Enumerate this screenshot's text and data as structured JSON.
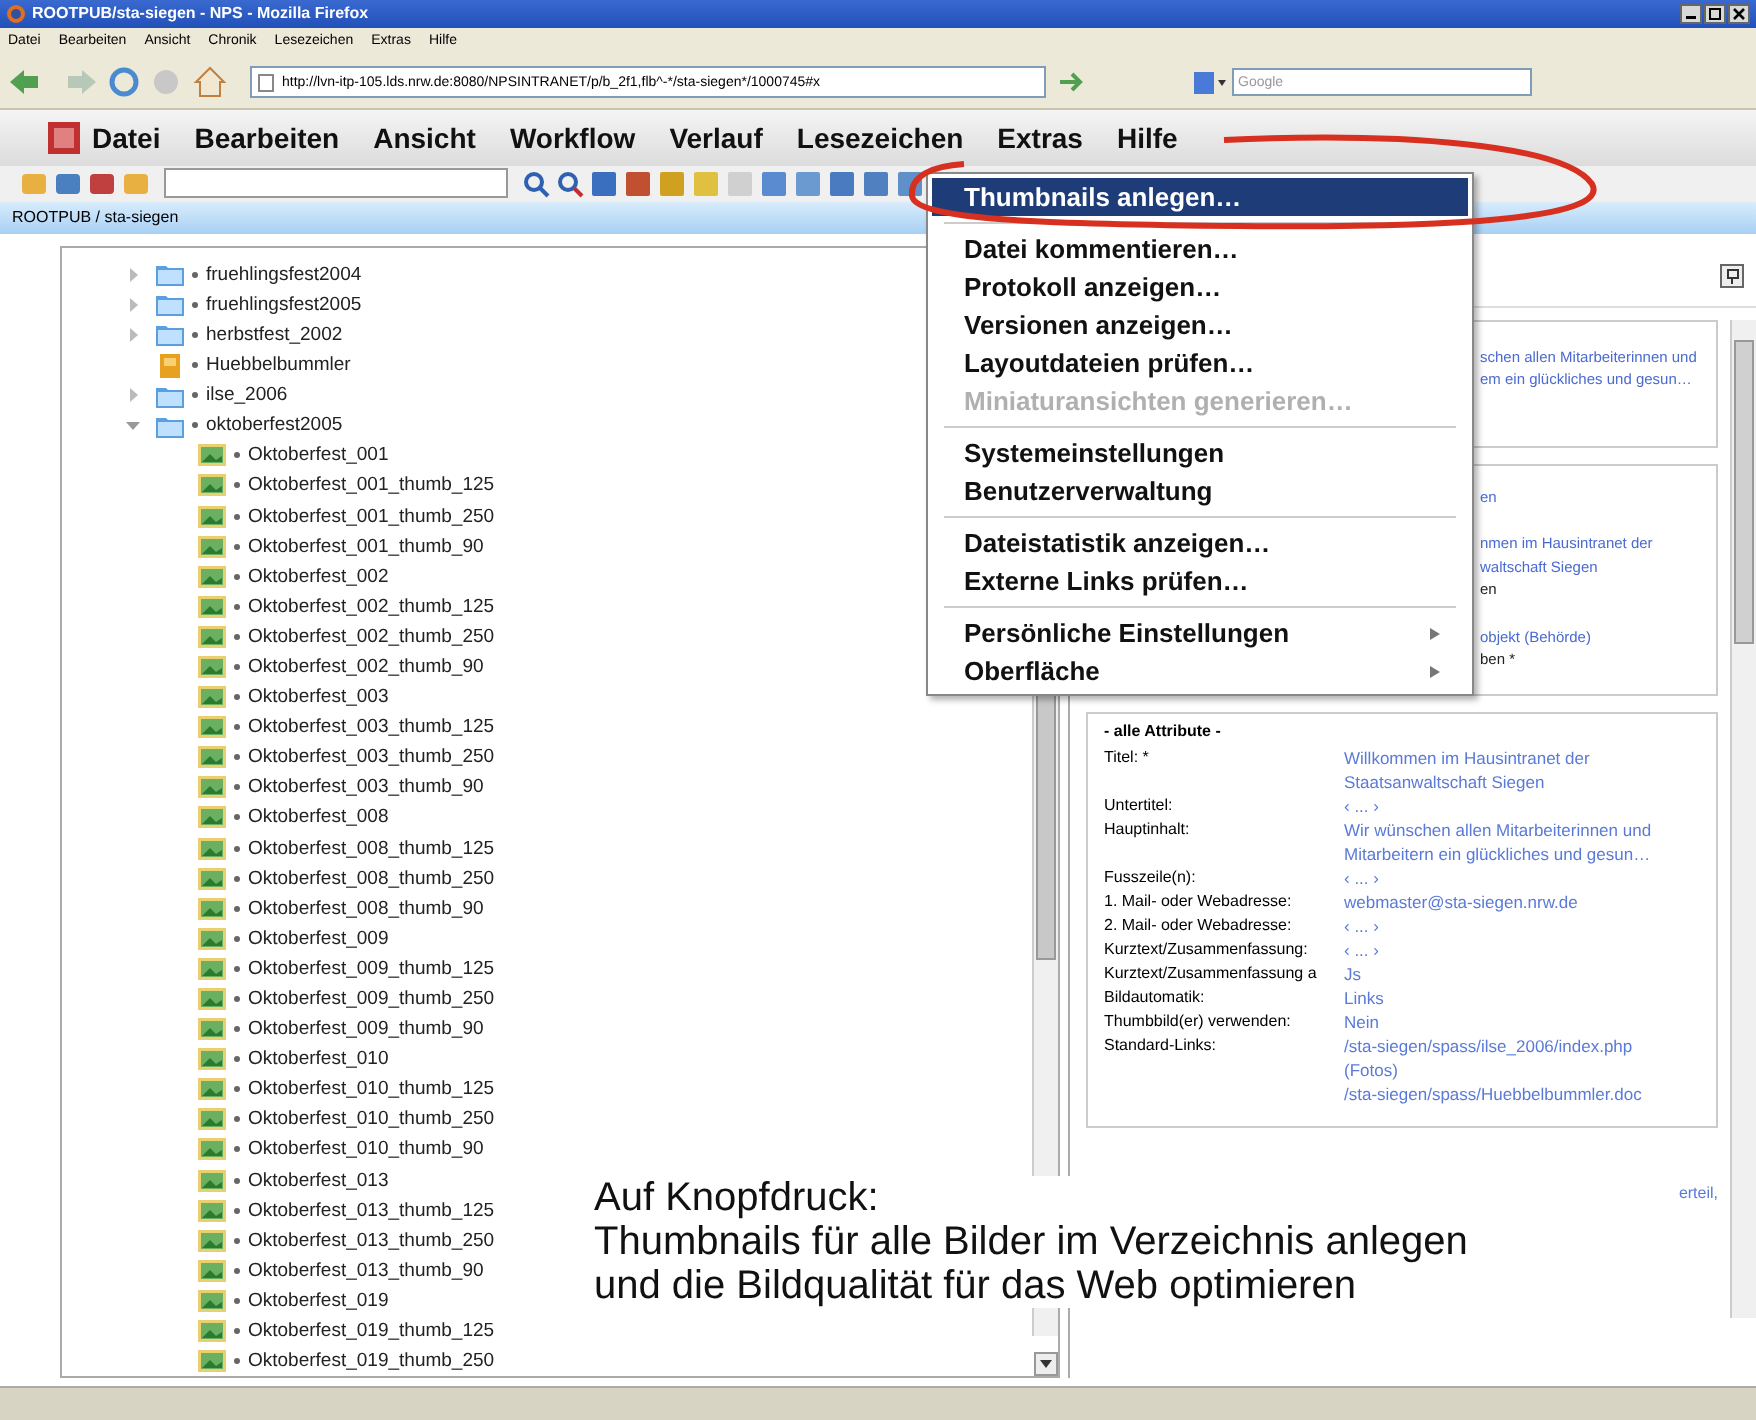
{
  "window": {
    "title": "ROOTPUB/sta-siegen - NPS - Mozilla Firefox"
  },
  "browser_menu": [
    "Datei",
    "Bearbeiten",
    "Ansicht",
    "Chronik",
    "Lesezeichen",
    "Extras",
    "Hilfe"
  ],
  "address_bar": {
    "url": "http://lvn-itp-105.lds.nrw.de:8080/NPSINTRANET/p/b_2f1,flb^-*/sta-siegen*/1000745#x"
  },
  "search": {
    "placeholder": "Google"
  },
  "app_menu": [
    "Datei",
    "Bearbeiten",
    "Ansicht",
    "Workflow",
    "Verlauf",
    "Lesezeichen",
    "Extras",
    "Hilfe"
  ],
  "breadcrumb": "ROOTPUB / sta-siegen",
  "tree": [
    {
      "name": "fruehlingsfest2004",
      "kind": "folder",
      "expanded": false
    },
    {
      "name": "fruehlingsfest2005",
      "kind": "folder",
      "expanded": false
    },
    {
      "name": "herbstfest_2002",
      "kind": "folder",
      "expanded": false
    },
    {
      "name": "Huebbelbummler",
      "kind": "document"
    },
    {
      "name": "ilse_2006",
      "kind": "folder",
      "expanded": false
    },
    {
      "name": "oktoberfest2005",
      "kind": "folder",
      "expanded": true,
      "children": [
        {
          "name": "Oktoberfest_001",
          "kind": "image"
        },
        {
          "name": "Oktoberfest_001_thumb_125",
          "kind": "image"
        },
        {
          "name": "Oktoberfest_001_thumb_250",
          "kind": "image"
        },
        {
          "name": "Oktoberfest_001_thumb_90",
          "kind": "image"
        },
        {
          "name": "Oktoberfest_002",
          "kind": "image"
        },
        {
          "name": "Oktoberfest_002_thumb_125",
          "kind": "image"
        },
        {
          "name": "Oktoberfest_002_thumb_250",
          "kind": "image"
        },
        {
          "name": "Oktoberfest_002_thumb_90",
          "kind": "image"
        },
        {
          "name": "Oktoberfest_003",
          "kind": "image"
        },
        {
          "name": "Oktoberfest_003_thumb_125",
          "kind": "image"
        },
        {
          "name": "Oktoberfest_003_thumb_250",
          "kind": "image"
        },
        {
          "name": "Oktoberfest_003_thumb_90",
          "kind": "image"
        },
        {
          "name": "Oktoberfest_008",
          "kind": "image"
        },
        {
          "name": "Oktoberfest_008_thumb_125",
          "kind": "image"
        },
        {
          "name": "Oktoberfest_008_thumb_250",
          "kind": "image"
        },
        {
          "name": "Oktoberfest_008_thumb_90",
          "kind": "image"
        },
        {
          "name": "Oktoberfest_009",
          "kind": "image"
        },
        {
          "name": "Oktoberfest_009_thumb_125",
          "kind": "image"
        },
        {
          "name": "Oktoberfest_009_thumb_250",
          "kind": "image"
        },
        {
          "name": "Oktoberfest_009_thumb_90",
          "kind": "image"
        },
        {
          "name": "Oktoberfest_010",
          "kind": "image"
        },
        {
          "name": "Oktoberfest_010_thumb_125",
          "kind": "image"
        },
        {
          "name": "Oktoberfest_010_thumb_250",
          "kind": "image"
        },
        {
          "name": "Oktoberfest_010_thumb_90",
          "kind": "image"
        },
        {
          "name": "Oktoberfest_013",
          "kind": "image"
        },
        {
          "name": "Oktoberfest_013_thumb_125",
          "kind": "image"
        },
        {
          "name": "Oktoberfest_013_thumb_250",
          "kind": "image"
        },
        {
          "name": "Oktoberfest_013_thumb_90",
          "kind": "image"
        },
        {
          "name": "Oktoberfest_019",
          "kind": "image"
        },
        {
          "name": "Oktoberfest_019_thumb_125",
          "kind": "image"
        },
        {
          "name": "Oktoberfest_019_thumb_250",
          "kind": "image"
        }
      ]
    }
  ],
  "detail_panel": {
    "summary_groups": [
      [
        {
          "text": "schen allen Mitarbeiterinnen und",
          "link": true
        },
        {
          "text": "em ein glückliches und gesun…",
          "link": true
        }
      ]
    ],
    "info_groups": [
      [
        {
          "text": "en",
          "link": true
        }
      ],
      [
        {
          "text": "nmen im Hausintranet der",
          "link": true
        },
        {
          "text": "waltschaft Siegen",
          "link": true
        },
        {
          "text": "en",
          "link": false
        }
      ],
      [
        {
          "text": "objekt (Behörde)",
          "link": true
        },
        {
          "text": "ben *",
          "link": false
        }
      ]
    ],
    "attributes_title": "- alle Attribute -",
    "attributes": [
      {
        "label": "Titel: *",
        "values": [
          "Willkommen im Hausintranet der Staatsanwaltschaft Siegen"
        ]
      },
      {
        "label": "Untertitel:",
        "values": [
          "‹ ... ›"
        ]
      },
      {
        "label": "Hauptinhalt:",
        "values": [
          "Wir wünschen allen Mitarbeiterinnen und Mitarbeitern ein glückliches und gesun…"
        ]
      },
      {
        "label": "Fusszeile(n):",
        "values": [
          "‹ ... ›"
        ]
      },
      {
        "label": "1. Mail- oder Webadresse:",
        "values": [
          "webmaster@sta-siegen.nrw.de"
        ]
      },
      {
        "label": "2. Mail- oder Webadresse:",
        "values": [
          "‹ ... ›"
        ]
      },
      {
        "label": "Kurztext/Zusammenfassung:",
        "values": [
          "‹ ... ›"
        ]
      },
      {
        "label": "Kurztext/Zusammenfassung a",
        "values": [
          "Js"
        ]
      },
      {
        "label": "Bildautomatik:",
        "values": [
          "Links"
        ]
      },
      {
        "label": "Thumbbild(er) verwenden:",
        "values": [
          "Nein"
        ]
      },
      {
        "label": "Standard-Links:",
        "values": [
          "/sta-siegen/spass/ilse_2006/index.php (Fotos)",
          "/sta-siegen/spass/Huebbelbummler.doc"
        ]
      }
    ],
    "trailing_text": "erteil,"
  },
  "dropdown": [
    {
      "kind": "item",
      "label": "Thumbnails anlegen…",
      "selected": true,
      "disabled": false,
      "submenu": false
    },
    {
      "kind": "separator"
    },
    {
      "kind": "item",
      "label": "Datei kommentieren…",
      "selected": false,
      "disabled": false,
      "submenu": false
    },
    {
      "kind": "item",
      "label": "Protokoll anzeigen…",
      "selected": false,
      "disabled": false,
      "submenu": false
    },
    {
      "kind": "item",
      "label": "Versionen anzeigen…",
      "selected": false,
      "disabled": false,
      "submenu": false
    },
    {
      "kind": "item",
      "label": "Layoutdateien prüfen…",
      "selected": false,
      "disabled": false,
      "submenu": false
    },
    {
      "kind": "item",
      "label": "Miniaturansichten generieren…",
      "selected": false,
      "disabled": true,
      "submenu": false
    },
    {
      "kind": "separator"
    },
    {
      "kind": "item",
      "label": "Systemeinstellungen",
      "selected": false,
      "disabled": false,
      "submenu": false
    },
    {
      "kind": "item",
      "label": "Benutzerverwaltung",
      "selected": false,
      "disabled": false,
      "submenu": false
    },
    {
      "kind": "separator"
    },
    {
      "kind": "item",
      "label": "Dateistatistik anzeigen…",
      "selected": false,
      "disabled": false,
      "submenu": false
    },
    {
      "kind": "item",
      "label": "Externe Links prüfen…",
      "selected": false,
      "disabled": false,
      "submenu": false
    },
    {
      "kind": "separator"
    },
    {
      "kind": "item",
      "label": "Persönliche Einstellungen",
      "selected": false,
      "disabled": false,
      "submenu": true
    },
    {
      "kind": "item",
      "label": "Oberfläche",
      "selected": false,
      "disabled": false,
      "submenu": true
    }
  ],
  "annotation": {
    "lines": [
      "Auf Knopfdruck:",
      "Thumbnails für alle Bilder im Verzeichnis anlegen",
      "und die Bildqualität für das Web optimieren"
    ]
  }
}
